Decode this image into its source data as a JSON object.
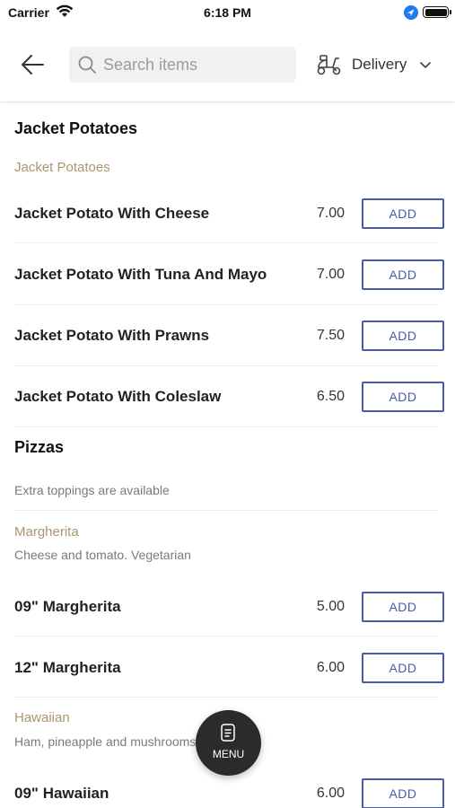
{
  "status_bar": {
    "carrier": "Carrier",
    "time": "6:18 PM",
    "icons": [
      "wifi-icon",
      "location-icon",
      "battery-icon"
    ]
  },
  "header": {
    "search": {
      "placeholder": "Search items",
      "value": ""
    },
    "delivery_label": "Delivery",
    "icons": [
      "back-arrow-icon",
      "search-icon",
      "scooter-icon",
      "chevron-down-icon"
    ]
  },
  "sections": [
    {
      "title": "Jacket Potatoes",
      "subcategories": [
        {
          "name": "Jacket Potatoes",
          "items": [
            {
              "name": "Jacket Potato With Cheese",
              "price": "7.00",
              "button": "ADD"
            },
            {
              "name": "Jacket Potato With Tuna And Mayo",
              "price": "7.00",
              "button": "ADD"
            },
            {
              "name": "Jacket Potato With Prawns",
              "price": "7.50",
              "button": "ADD"
            },
            {
              "name": "Jacket Potato With Coleslaw",
              "price": "6.50",
              "button": "ADD"
            }
          ]
        }
      ]
    },
    {
      "title": "Pizzas",
      "note": "Extra toppings are available",
      "subcategories": [
        {
          "name": "Margherita",
          "description": "Cheese and tomato. Vegetarian",
          "items": [
            {
              "name": "09\" Margherita",
              "price": "5.00",
              "button": "ADD"
            },
            {
              "name": "12\" Margherita",
              "price": "6.00",
              "button": "ADD"
            }
          ]
        },
        {
          "name": "Hawaiian",
          "description": "Ham, pineapple and mushrooms",
          "items": [
            {
              "name": "09\" Hawaiian",
              "price": "6.00",
              "button": "ADD"
            }
          ]
        }
      ]
    }
  ],
  "menu_fab": {
    "label": "MENU",
    "icon": "menu-card-icon"
  },
  "colors": {
    "accent": "#4a5aa8",
    "subcategory": "#a99770",
    "fab": "#2b2b2b",
    "location": "#1e7cf2"
  }
}
